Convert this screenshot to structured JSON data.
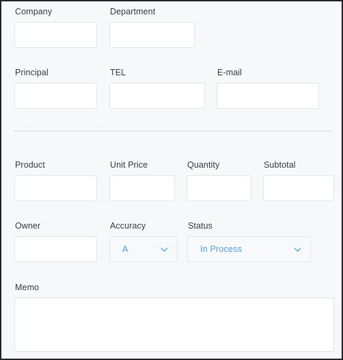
{
  "form": {
    "background_color": "#f7f8fa",
    "border_color": "#222226",
    "label_color": "#35393d",
    "input_border_color": "#e3e5e8",
    "accent_color": "#4c9ce0",
    "rows": {
      "contact_row_1": [
        {
          "label": "Company",
          "value": "",
          "placeholder": ""
        },
        {
          "label": "Department",
          "value": "",
          "placeholder": ""
        }
      ],
      "contact_row_2": [
        {
          "label": "Principal",
          "value": "",
          "placeholder": ""
        },
        {
          "label": "TEL",
          "value": "",
          "placeholder": ""
        },
        {
          "label": "E-mail",
          "value": "",
          "placeholder": ""
        }
      ],
      "order_row_1": [
        {
          "label": "Product",
          "value": "",
          "placeholder": ""
        },
        {
          "label": "Unit Price",
          "value": "",
          "placeholder": ""
        },
        {
          "label": "Quantity",
          "value": "",
          "placeholder": ""
        },
        {
          "label": "Subtotal",
          "value": "",
          "placeholder": ""
        }
      ],
      "order_row_2": [
        {
          "label": "Owner",
          "value": "",
          "placeholder": ""
        },
        {
          "label": "Accuracy",
          "selected": "A",
          "icon": "chevron-down-icon"
        },
        {
          "label": "Status",
          "selected": "In Process",
          "icon": "chevron-down-icon"
        }
      ],
      "memo": {
        "label": "Memo",
        "value": "",
        "placeholder": ""
      }
    }
  }
}
